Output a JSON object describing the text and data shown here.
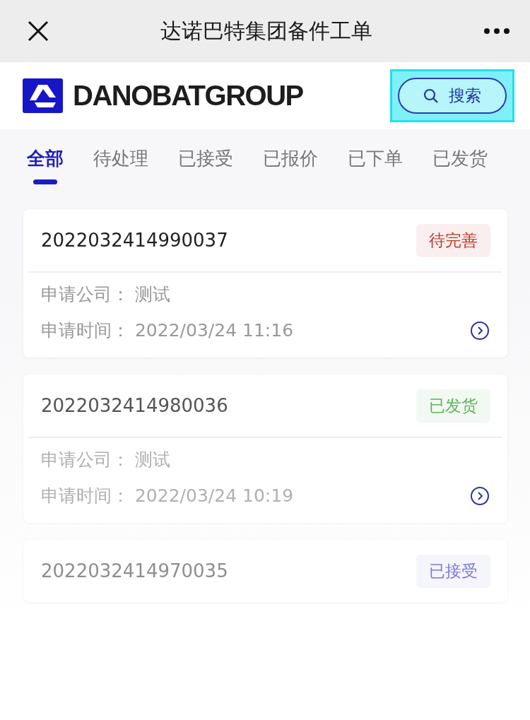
{
  "nav": {
    "title": "达诺巴特集团备件工单"
  },
  "header": {
    "logo_text": "DANOBATGROUP",
    "search_label": "搜索"
  },
  "tabs": [
    {
      "label": "全部",
      "selected": true
    },
    {
      "label": "待处理",
      "selected": false
    },
    {
      "label": "已接受",
      "selected": false
    },
    {
      "label": "已报价",
      "selected": false
    },
    {
      "label": "已下单",
      "selected": false
    },
    {
      "label": "已发货",
      "selected": false
    }
  ],
  "orders": [
    {
      "number": "2022032414990037",
      "status": "待完善",
      "color": "#c0392b",
      "fields": [
        {
          "label": "申请公司：",
          "value": "测试"
        },
        {
          "label": "申请时间：",
          "value": "2022/03/24 11:16"
        }
      ]
    },
    {
      "number": "2022032414980036",
      "status": "已发货",
      "color": "#5fb35c",
      "fields": [
        {
          "label": "申请公司：",
          "value": "测试"
        },
        {
          "label": "申请时间：",
          "value": "2022/03/24 10:19"
        }
      ]
    },
    {
      "number": "2022032414970035",
      "status": "已接受",
      "color": "#7a7ad8"
    }
  ]
}
